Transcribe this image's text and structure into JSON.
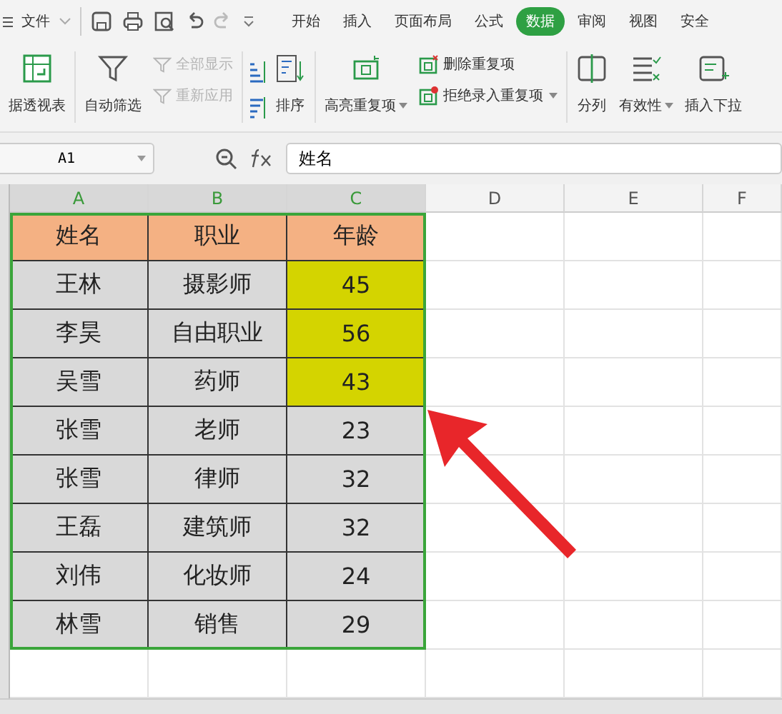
{
  "menu_bar": {
    "file_menu": "文件",
    "tabs": [
      {
        "label": "开始",
        "selected": false
      },
      {
        "label": "插入",
        "selected": false
      },
      {
        "label": "页面布局",
        "selected": false
      },
      {
        "label": "公式",
        "selected": false
      },
      {
        "label": "数据",
        "selected": true
      },
      {
        "label": "审阅",
        "selected": false
      },
      {
        "label": "视图",
        "selected": false
      },
      {
        "label": "安全",
        "selected": false
      }
    ]
  },
  "ribbon": {
    "groups": [
      {
        "items": [
          {
            "kind": "large",
            "label": "据透视表",
            "dropdown": false,
            "disabled": false
          }
        ]
      },
      {
        "items": [
          {
            "kind": "large",
            "label": "自动筛选",
            "dropdown": false,
            "disabled": false
          },
          {
            "kind": "small",
            "label": "全部显示",
            "dropdown": false,
            "disabled": true
          },
          {
            "kind": "small",
            "label": "重新应用",
            "dropdown": false,
            "disabled": true
          }
        ]
      },
      {
        "items": [
          {
            "kind": "large",
            "label": "排序",
            "dropdown": false,
            "disabled": false
          }
        ]
      },
      {
        "items": [
          {
            "kind": "large",
            "label": "高亮重复项",
            "dropdown": true,
            "disabled": false
          },
          {
            "kind": "small",
            "label": "删除重复项",
            "dropdown": false,
            "disabled": false
          },
          {
            "kind": "small",
            "label": "拒绝录入重复项",
            "dropdown": true,
            "disabled": false
          }
        ]
      },
      {
        "items": [
          {
            "kind": "large",
            "label": "分列",
            "dropdown": false,
            "disabled": false
          },
          {
            "kind": "large",
            "label": "有效性",
            "dropdown": true,
            "disabled": false
          },
          {
            "kind": "large",
            "label": "插入下拉",
            "dropdown": false,
            "disabled": false
          }
        ]
      }
    ]
  },
  "formula_bar": {
    "name_box": "A1",
    "formula": "姓名"
  },
  "columns": [
    {
      "label": "A",
      "selected": true
    },
    {
      "label": "B",
      "selected": true
    },
    {
      "label": "C",
      "selected": true
    },
    {
      "label": "D",
      "selected": false
    },
    {
      "label": "E",
      "selected": false
    },
    {
      "label": "F",
      "selected": false
    }
  ],
  "rows": [
    {
      "kind": "header",
      "cells": [
        {
          "text": "姓名"
        },
        {
          "text": "职业"
        },
        {
          "text": "年龄"
        }
      ]
    },
    {
      "kind": "data",
      "cells": [
        {
          "text": "王林",
          "highlighted": false
        },
        {
          "text": "摄影师",
          "highlighted": false
        },
        {
          "text": "45",
          "highlighted": true
        }
      ]
    },
    {
      "kind": "data",
      "cells": [
        {
          "text": "李昊",
          "highlighted": false
        },
        {
          "text": "自由职业",
          "highlighted": false
        },
        {
          "text": "56",
          "highlighted": true
        }
      ]
    },
    {
      "kind": "data",
      "cells": [
        {
          "text": "吴雪",
          "highlighted": false
        },
        {
          "text": "药师",
          "highlighted": false
        },
        {
          "text": "43",
          "highlighted": true
        }
      ]
    },
    {
      "kind": "data",
      "cells": [
        {
          "text": "张雪",
          "highlighted": false
        },
        {
          "text": "老师",
          "highlighted": false
        },
        {
          "text": "23",
          "highlighted": false
        }
      ]
    },
    {
      "kind": "data",
      "cells": [
        {
          "text": "张雪",
          "highlighted": false
        },
        {
          "text": "律师",
          "highlighted": false
        },
        {
          "text": "32",
          "highlighted": false
        }
      ]
    },
    {
      "kind": "data",
      "cells": [
        {
          "text": "王磊",
          "highlighted": false
        },
        {
          "text": "建筑师",
          "highlighted": false
        },
        {
          "text": "32",
          "highlighted": false
        }
      ]
    },
    {
      "kind": "data",
      "cells": [
        {
          "text": "刘伟",
          "highlighted": false
        },
        {
          "text": "化妆师",
          "highlighted": false
        },
        {
          "text": "24",
          "highlighted": false
        }
      ]
    },
    {
      "kind": "data",
      "cells": [
        {
          "text": "林雪",
          "highlighted": false
        },
        {
          "text": "销售",
          "highlighted": false
        },
        {
          "text": "29",
          "highlighted": false
        }
      ]
    }
  ]
}
